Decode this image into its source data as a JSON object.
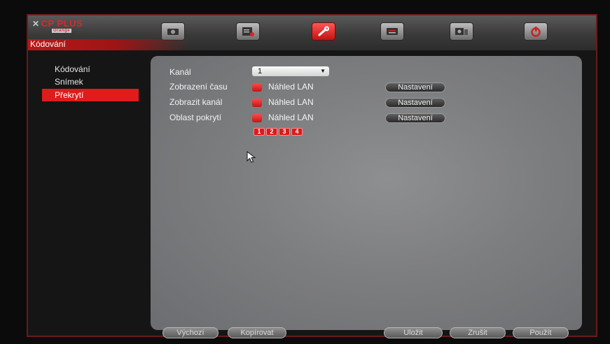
{
  "brand": {
    "name": "CP PLUS",
    "sub": "Orange"
  },
  "window": {
    "title": "Kódování"
  },
  "toolbar": {
    "icons": [
      {
        "name": "camera-icon"
      },
      {
        "name": "record-icon"
      },
      {
        "name": "settings-wrench-icon",
        "active": true
      },
      {
        "name": "network-icon"
      },
      {
        "name": "system-info-icon"
      },
      {
        "name": "shutdown-icon"
      }
    ]
  },
  "sidebar": {
    "items": [
      {
        "label": "Kódování"
      },
      {
        "label": "Snímek"
      },
      {
        "label": "Překrytí",
        "active": true
      }
    ]
  },
  "form": {
    "channel_label": "Kanál",
    "channel_value": "1",
    "rows": [
      {
        "label": "Zobrazení času",
        "checkbox_label": "Náhled LAN",
        "checked": true,
        "button": "Nastavení"
      },
      {
        "label": "Zobrazit kanál",
        "checkbox_label": "Náhled LAN",
        "checked": true,
        "button": "Nastavení"
      },
      {
        "label": "Oblast pokrytí",
        "checkbox_label": "Náhled LAN",
        "checked": true,
        "button": "Nastavení"
      }
    ],
    "regions": [
      "1",
      "2",
      "3",
      "4"
    ]
  },
  "footer": {
    "default_label": "Výchozí",
    "copy_label": "Kopírovat",
    "save_label": "Uložit",
    "cancel_label": "Zrušit",
    "apply_label": "Použít"
  },
  "colors": {
    "accent": "#e01b1b",
    "panel": "#7d7e80",
    "background": "#151515"
  }
}
